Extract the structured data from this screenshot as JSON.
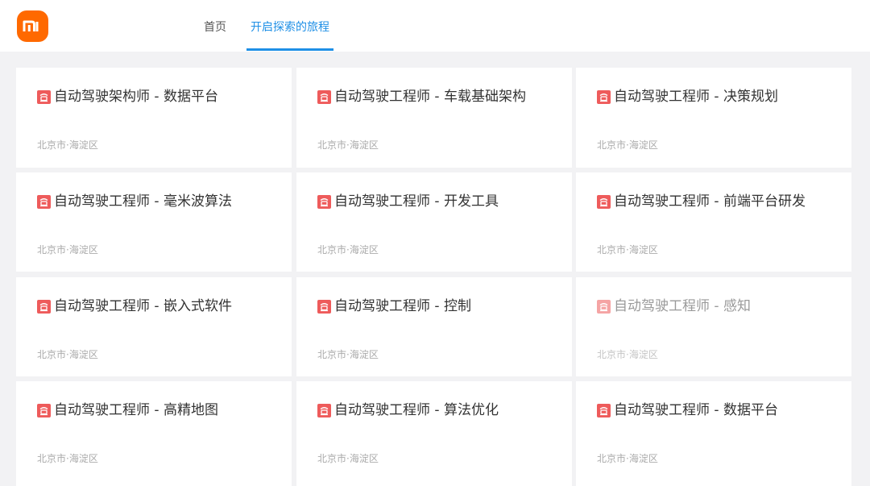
{
  "header": {
    "logo_text": "mi",
    "brand_color": "#ff6900",
    "tabs": [
      {
        "label": "首页",
        "active": false
      },
      {
        "label": "开启探索的旅程",
        "active": true
      }
    ],
    "accent_color": "#1e8fe6"
  },
  "jobs": [
    {
      "title": "自动驾驶架构师 - 数据平台",
      "location": "北京市·海淀区",
      "icon": "job-badge-icon"
    },
    {
      "title": "自动驾驶工程师 - 车载基础架构",
      "location": "北京市·海淀区",
      "icon": "job-badge-icon"
    },
    {
      "title": "自动驾驶工程师 - 决策规划",
      "location": "北京市·海淀区",
      "icon": "job-badge-icon"
    },
    {
      "title": "自动驾驶工程师 - 毫米波算法",
      "location": "北京市·海淀区",
      "icon": "job-badge-icon"
    },
    {
      "title": "自动驾驶工程师 - 开发工具",
      "location": "北京市·海淀区",
      "icon": "job-badge-icon"
    },
    {
      "title": "自动驾驶工程师 - 前端平台研发",
      "location": "北京市·海淀区",
      "icon": "job-badge-icon"
    },
    {
      "title": "自动驾驶工程师 - 嵌入式软件",
      "location": "北京市·海淀区",
      "icon": "job-badge-icon"
    },
    {
      "title": "自动驾驶工程师 - 控制",
      "location": "北京市·海淀区",
      "icon": "job-badge-icon"
    },
    {
      "title": "自动驾驶工程师 - 感知",
      "location": "北京市·海淀区",
      "icon": "job-badge-icon",
      "faded": true
    },
    {
      "title": "自动驾驶工程师 - 高精地图",
      "location": "北京市·海淀区",
      "icon": "job-badge-icon"
    },
    {
      "title": "自动驾驶工程师 - 算法优化",
      "location": "北京市·海淀区",
      "icon": "job-badge-icon"
    },
    {
      "title": "自动驾驶工程师 - 数据平台",
      "location": "北京市·海淀区",
      "icon": "job-badge-icon"
    }
  ]
}
